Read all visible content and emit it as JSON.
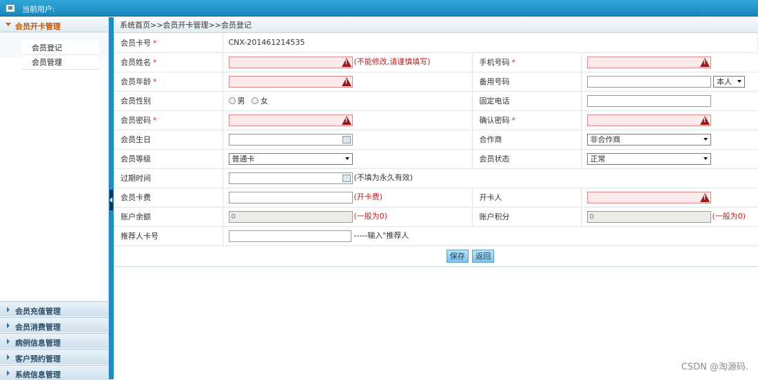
{
  "header": {
    "current_user_label": "当前用户:"
  },
  "sidebar": {
    "open_section": {
      "label": "会员开卡管理",
      "items": [
        "会员登记",
        "会员管理"
      ]
    },
    "closed_sections": [
      "会员充值管理",
      "会员消费管理",
      "病例信息管理",
      "客户预约管理",
      "系统信息管理"
    ]
  },
  "breadcrumb": "系统首页>>会员开卡管理>>会员登记",
  "form": {
    "card_no_label": "会员卡号",
    "card_no_value": "CNX-201461214535",
    "name_label": "会员姓名",
    "name_hint": "(不能修改,请谨慎填写)",
    "phone_label": "手机号码",
    "age_label": "会员年龄",
    "alt_phone_label": "备用号码",
    "alt_phone_select": "本人",
    "gender_label": "会员性别",
    "gender_male": "男",
    "gender_female": "女",
    "landline_label": "固定电话",
    "password_label": "会员密码",
    "confirm_label": "确认密码",
    "birthday_label": "会员生日",
    "partner_label": "合作商",
    "partner_value": "非合作商",
    "level_label": "会员等级",
    "level_value": "普通卡",
    "status_label": "会员状态",
    "status_value": "正常",
    "expire_label": "过期时间",
    "expire_hint": "(不填为永久有效)",
    "fee_label": "会员卡费",
    "fee_hint": "(开卡费)",
    "opener_label": "开卡人",
    "balance_label": "账户余额",
    "balance_value": "0",
    "balance_hint": "(一般为0)",
    "points_label": "账户积分",
    "points_value": "0",
    "points_hint": "(一般为0)",
    "referrer_label": "推荐人卡号",
    "referrer_hint": "-----输入\"推荐人"
  },
  "buttons": {
    "save": "保存",
    "back": "返回"
  },
  "watermark": "CSDN @淘源码.",
  "colors": {
    "topbar": "#1b86bd",
    "accent": "#cc5500",
    "error": "#a01818"
  }
}
